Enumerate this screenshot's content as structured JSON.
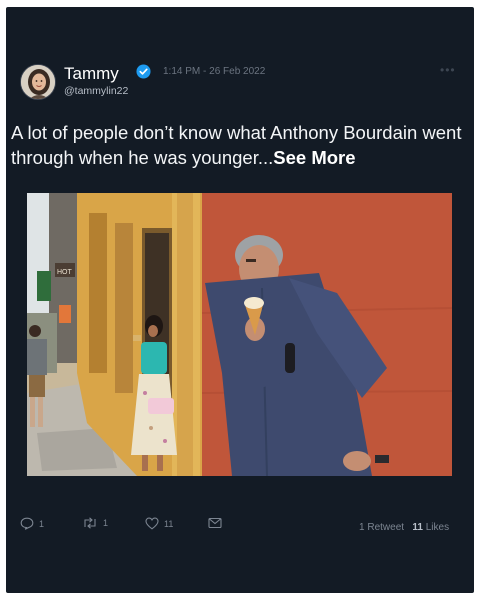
{
  "tweet": {
    "author_name": "Tammy",
    "author_handle": "@tammylin22",
    "timestamp": "1:14 PM - 26 Feb 2022",
    "text": "A lot of people don’t know what Anthony Bourdain went through when he was younger...",
    "see_more": "See More",
    "verified": true,
    "avatar_icon": "avatar-photo",
    "more_icon": "more-dots-icon"
  },
  "photo": {
    "sign_text": "HOT"
  },
  "actions": {
    "replies": "1",
    "retweets": "1",
    "likes": "11"
  },
  "stats": {
    "retweet_count": "1",
    "retweet_label": "Retweet",
    "like_count": "11",
    "like_label": "Likes"
  },
  "colors": {
    "background": "#131b25",
    "verified": "#1d9bf0",
    "wall": "#c65a3c",
    "shirt": "#3e4a6e"
  }
}
